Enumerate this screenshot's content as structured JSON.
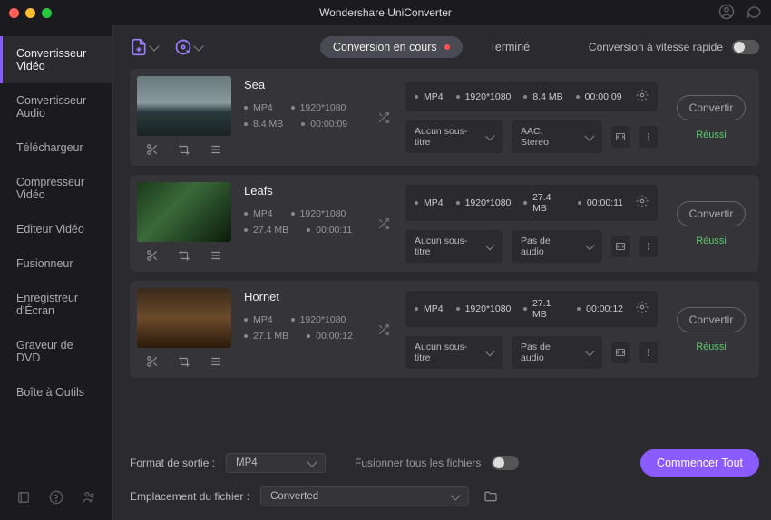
{
  "app_title": "Wondershare UniConverter",
  "sidebar": {
    "items": [
      {
        "label": "Convertisseur Vidéo",
        "active": true
      },
      {
        "label": "Convertisseur Audio"
      },
      {
        "label": "Téléchargeur"
      },
      {
        "label": "Compresseur Vidéo"
      },
      {
        "label": "Editeur Vidéo"
      },
      {
        "label": "Fusionneur"
      },
      {
        "label": "Enregistreur d'Écran"
      },
      {
        "label": "Graveur de DVD"
      },
      {
        "label": "Boîte à Outils"
      }
    ]
  },
  "toolbar": {
    "tabs": [
      {
        "label": "Conversion en cours",
        "active": true
      },
      {
        "label": "Terminé"
      }
    ],
    "speed_label": "Conversion à vitesse rapide"
  },
  "items": [
    {
      "title": "Sea",
      "thumb_class": "sea",
      "src_format": "MP4",
      "src_resolution": "1920*1080",
      "src_size": "8.4 MB",
      "src_duration": "00:00:09",
      "out_format": "MP4",
      "out_resolution": "1920*1080",
      "out_size": "8.4 MB",
      "out_duration": "00:00:09",
      "subtitle": "Aucun sous-titre",
      "audio": "AAC, Stereo",
      "convert_label": "Convertir",
      "status": "Réussi"
    },
    {
      "title": "Leafs",
      "thumb_class": "leafs",
      "src_format": "MP4",
      "src_resolution": "1920*1080",
      "src_size": "27.4 MB",
      "src_duration": "00:00:11",
      "out_format": "MP4",
      "out_resolution": "1920*1080",
      "out_size": "27.4 MB",
      "out_duration": "00:00:11",
      "subtitle": "Aucun sous-titre",
      "audio": "Pas de audio",
      "convert_label": "Convertir",
      "status": "Réussi"
    },
    {
      "title": "Hornet",
      "thumb_class": "hornet",
      "src_format": "MP4",
      "src_resolution": "1920*1080",
      "src_size": "27.1 MB",
      "src_duration": "00:00:12",
      "out_format": "MP4",
      "out_resolution": "1920*1080",
      "out_size": "27.1 MB",
      "out_duration": "00:00:12",
      "subtitle": "Aucun sous-titre",
      "audio": "Pas de audio",
      "convert_label": "Convertir",
      "status": "Réussi"
    }
  ],
  "footer": {
    "output_format_label": "Format de sortie :",
    "output_format_value": "MP4",
    "merge_label": "Fusionner tous les fichiers",
    "location_label": "Emplacement du fichier :",
    "location_value": "Converted",
    "start_label": "Commencer Tout"
  }
}
